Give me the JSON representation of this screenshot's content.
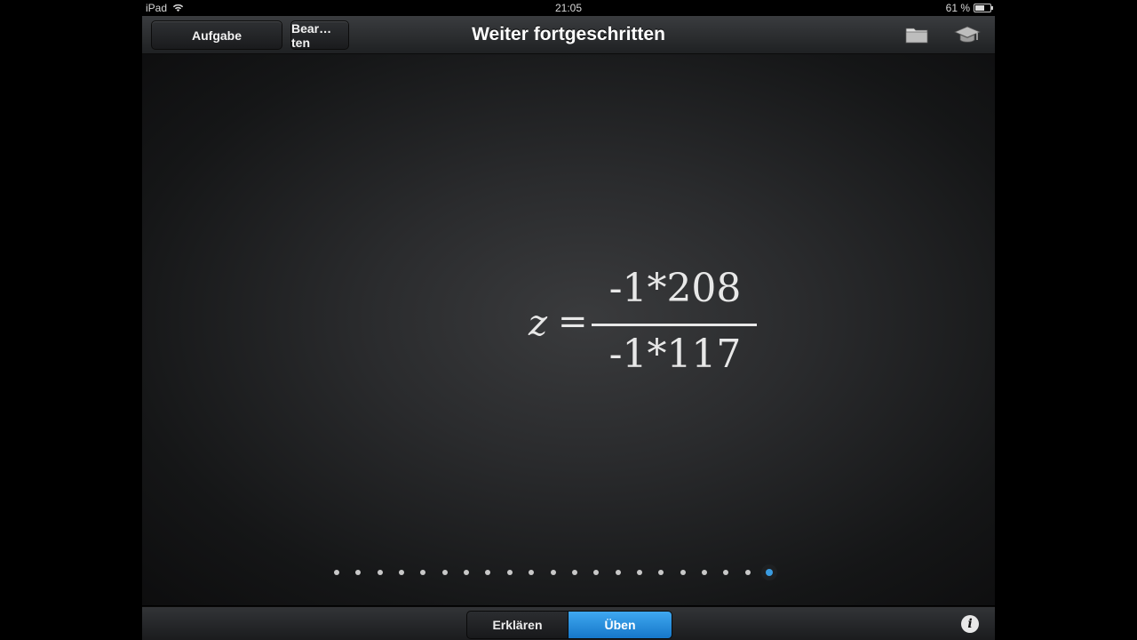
{
  "status": {
    "device": "iPad",
    "time": "21:05",
    "battery": "61 %",
    "battery_level": 0.61
  },
  "navbar": {
    "title": "Weiter fortgeschritten",
    "left_button": "Aufgabe",
    "edit_button": "Bear…ten",
    "icons": [
      "folder-icon",
      "graduation-cap-icon"
    ]
  },
  "formula": {
    "variable": "z",
    "equals": "=",
    "numerator": "-1*208",
    "denominator": "-1*117"
  },
  "pager": {
    "count": 21,
    "current": 21
  },
  "toolbar": {
    "segments": [
      "Erklären",
      "Üben"
    ],
    "selected": "Üben",
    "info_label": "i"
  }
}
